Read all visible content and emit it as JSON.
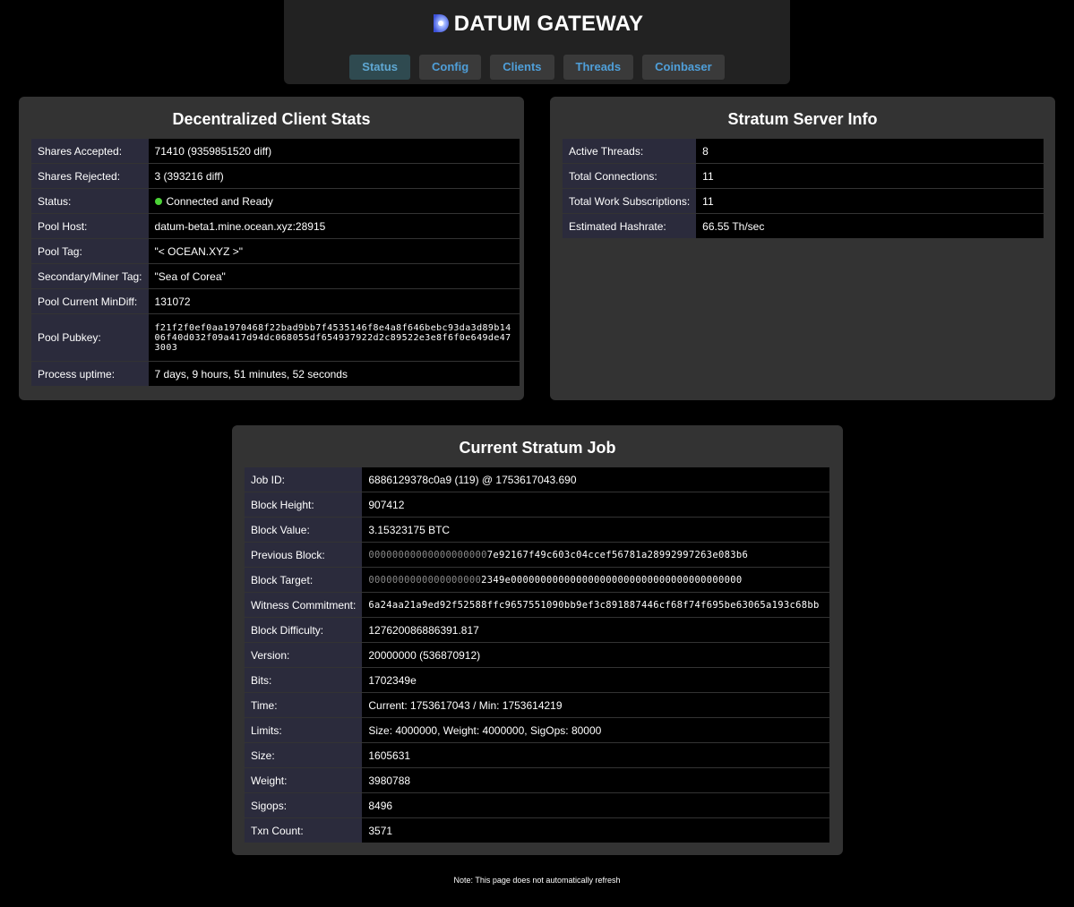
{
  "header": {
    "title": "DATUM GATEWAY",
    "nav": [
      {
        "label": "Status",
        "active": true
      },
      {
        "label": "Config",
        "active": false
      },
      {
        "label": "Clients",
        "active": false
      },
      {
        "label": "Threads",
        "active": false
      },
      {
        "label": "Coinbaser",
        "active": false
      }
    ]
  },
  "client_stats": {
    "title": "Decentralized Client Stats",
    "rows": [
      {
        "label": "Shares Accepted:",
        "value": "71410 (9359851520 diff)"
      },
      {
        "label": "Shares Rejected:",
        "value": "3 (393216 diff)"
      },
      {
        "label": "Status:",
        "value": "Connected and Ready"
      },
      {
        "label": "Pool Host:",
        "value": "datum-beta1.mine.ocean.xyz:28915"
      },
      {
        "label": "Pool Tag:",
        "value": "\"< OCEAN.XYZ >\""
      },
      {
        "label": "Secondary/Miner Tag:",
        "value": "\"Sea of Corea\""
      },
      {
        "label": "Pool Current MinDiff:",
        "value": "131072"
      },
      {
        "label": "Pool Pubkey:",
        "value": "f21f2f0ef0aa1970468f22bad9bb7f4535146f8e4a8f646bebc93da3d89b1406f40d032f09a417d94dc068055df654937922d2c89522e3e8f6f0e649de473003"
      },
      {
        "label": "Process uptime:",
        "value": "7 days, 9 hours, 51 minutes, 52 seconds"
      }
    ]
  },
  "stratum_info": {
    "title": "Stratum Server Info",
    "rows": [
      {
        "label": "Active Threads:",
        "value": "8"
      },
      {
        "label": "Total Connections:",
        "value": "11"
      },
      {
        "label": "Total Work Subscriptions:",
        "value": "11"
      },
      {
        "label": "Estimated Hashrate:",
        "value": "66.55 Th/sec"
      }
    ]
  },
  "stratum_job": {
    "title": "Current Stratum Job",
    "rows": [
      {
        "label": "Job ID:",
        "value": "6886129378c0a9 (119) @ 1753617043.690"
      },
      {
        "label": "Block Height:",
        "value": "907412"
      },
      {
        "label": "Block Value:",
        "value": "3.15323175 BTC"
      },
      {
        "label": "Previous Block:",
        "value_dim": "00000000000000000000",
        "value": "7e92167f49c603c04ccef56781a28992997263e083b6"
      },
      {
        "label": "Block Target:",
        "value_dim": "0000000000000000000",
        "value": "2349e000000000000000000000000000000000000000"
      },
      {
        "label": "Witness Commitment:",
        "value": "6a24aa21a9ed92f52588ffc9657551090bb9ef3c891887446cf68f74f695be63065a193c68bb"
      },
      {
        "label": "Block Difficulty:",
        "value": "127620086886391.817"
      },
      {
        "label": "Version:",
        "value": "20000000 (536870912)"
      },
      {
        "label": "Bits:",
        "value": "1702349e"
      },
      {
        "label": "Time:",
        "value": "Current: 1753617043 / Min: 1753614219"
      },
      {
        "label": "Limits:",
        "value": "Size: 4000000, Weight: 4000000, SigOps: 80000"
      },
      {
        "label": "Size:",
        "value": "1605631"
      },
      {
        "label": "Weight:",
        "value": "3980788"
      },
      {
        "label": "Sigops:",
        "value": "8496"
      },
      {
        "label": "Txn Count:",
        "value": "3571"
      }
    ]
  },
  "footer": {
    "note": "Note: This page does not automatically refresh"
  },
  "colors": {
    "status_ok": "#4cd337",
    "nav_text": "#4f9fd9",
    "panel_bg": "#333333"
  }
}
